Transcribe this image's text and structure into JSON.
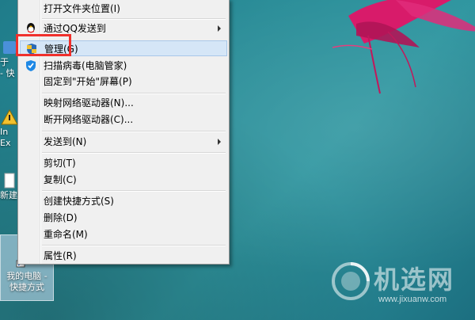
{
  "desktop": {
    "icons": [
      {
        "label": "于",
        "sub": "- 快"
      },
      {
        "label": "In",
        "sub": "Ex"
      },
      {
        "label": "新建"
      }
    ],
    "my_pc": {
      "label_line1": "我的电脑 -",
      "label_line2": "快捷方式"
    }
  },
  "context_menu": {
    "items": [
      {
        "label": "打开文件夹位置(I)",
        "icon": null,
        "submenu": false
      },
      {
        "label": "通过QQ发送到",
        "icon": "qq-penguin-icon",
        "submenu": true
      },
      {
        "label": "管理(G)",
        "icon": "shield-icon",
        "submenu": false,
        "highlighted": true
      },
      {
        "label": "扫描病毒(电脑管家)",
        "icon": "tencent-shield-icon",
        "submenu": false
      },
      {
        "label": "固定到\"开始\"屏幕(P)",
        "icon": null,
        "submenu": false
      },
      {
        "label": "映射网络驱动器(N)...",
        "icon": null,
        "submenu": false
      },
      {
        "label": "断开网络驱动器(C)...",
        "icon": null,
        "submenu": false
      },
      {
        "label": "发送到(N)",
        "icon": null,
        "submenu": true
      },
      {
        "label": "剪切(T)",
        "icon": null,
        "submenu": false
      },
      {
        "label": "复制(C)",
        "icon": null,
        "submenu": false
      },
      {
        "label": "创建快捷方式(S)",
        "icon": null,
        "submenu": false
      },
      {
        "label": "删除(D)",
        "icon": null,
        "submenu": false
      },
      {
        "label": "重命名(M)",
        "icon": null,
        "submenu": false
      },
      {
        "label": "属性(R)",
        "icon": null,
        "submenu": false
      }
    ]
  },
  "watermark": {
    "brand": "机选网",
    "url": "www.jixuanw.com"
  },
  "colors": {
    "highlight_box": "#f0302c",
    "menu_bg": "#f0f0f0",
    "hover_bg": "#d5e6f7"
  }
}
